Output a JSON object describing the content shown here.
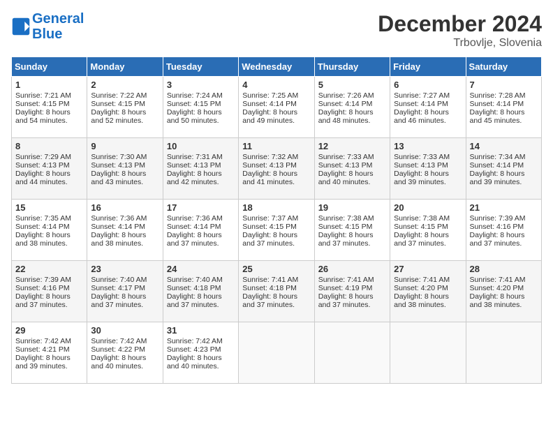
{
  "header": {
    "logo_line1": "General",
    "logo_line2": "Blue",
    "month_title": "December 2024",
    "location": "Trbovlje, Slovenia"
  },
  "days_of_week": [
    "Sunday",
    "Monday",
    "Tuesday",
    "Wednesday",
    "Thursday",
    "Friday",
    "Saturday"
  ],
  "weeks": [
    [
      {
        "day": "1",
        "lines": [
          "Sunrise: 7:21 AM",
          "Sunset: 4:15 PM",
          "Daylight: 8 hours",
          "and 54 minutes."
        ]
      },
      {
        "day": "2",
        "lines": [
          "Sunrise: 7:22 AM",
          "Sunset: 4:15 PM",
          "Daylight: 8 hours",
          "and 52 minutes."
        ]
      },
      {
        "day": "3",
        "lines": [
          "Sunrise: 7:24 AM",
          "Sunset: 4:15 PM",
          "Daylight: 8 hours",
          "and 50 minutes."
        ]
      },
      {
        "day": "4",
        "lines": [
          "Sunrise: 7:25 AM",
          "Sunset: 4:14 PM",
          "Daylight: 8 hours",
          "and 49 minutes."
        ]
      },
      {
        "day": "5",
        "lines": [
          "Sunrise: 7:26 AM",
          "Sunset: 4:14 PM",
          "Daylight: 8 hours",
          "and 48 minutes."
        ]
      },
      {
        "day": "6",
        "lines": [
          "Sunrise: 7:27 AM",
          "Sunset: 4:14 PM",
          "Daylight: 8 hours",
          "and 46 minutes."
        ]
      },
      {
        "day": "7",
        "lines": [
          "Sunrise: 7:28 AM",
          "Sunset: 4:14 PM",
          "Daylight: 8 hours",
          "and 45 minutes."
        ]
      }
    ],
    [
      {
        "day": "8",
        "lines": [
          "Sunrise: 7:29 AM",
          "Sunset: 4:13 PM",
          "Daylight: 8 hours",
          "and 44 minutes."
        ]
      },
      {
        "day": "9",
        "lines": [
          "Sunrise: 7:30 AM",
          "Sunset: 4:13 PM",
          "Daylight: 8 hours",
          "and 43 minutes."
        ]
      },
      {
        "day": "10",
        "lines": [
          "Sunrise: 7:31 AM",
          "Sunset: 4:13 PM",
          "Daylight: 8 hours",
          "and 42 minutes."
        ]
      },
      {
        "day": "11",
        "lines": [
          "Sunrise: 7:32 AM",
          "Sunset: 4:13 PM",
          "Daylight: 8 hours",
          "and 41 minutes."
        ]
      },
      {
        "day": "12",
        "lines": [
          "Sunrise: 7:33 AM",
          "Sunset: 4:13 PM",
          "Daylight: 8 hours",
          "and 40 minutes."
        ]
      },
      {
        "day": "13",
        "lines": [
          "Sunrise: 7:33 AM",
          "Sunset: 4:13 PM",
          "Daylight: 8 hours",
          "and 39 minutes."
        ]
      },
      {
        "day": "14",
        "lines": [
          "Sunrise: 7:34 AM",
          "Sunset: 4:14 PM",
          "Daylight: 8 hours",
          "and 39 minutes."
        ]
      }
    ],
    [
      {
        "day": "15",
        "lines": [
          "Sunrise: 7:35 AM",
          "Sunset: 4:14 PM",
          "Daylight: 8 hours",
          "and 38 minutes."
        ]
      },
      {
        "day": "16",
        "lines": [
          "Sunrise: 7:36 AM",
          "Sunset: 4:14 PM",
          "Daylight: 8 hours",
          "and 38 minutes."
        ]
      },
      {
        "day": "17",
        "lines": [
          "Sunrise: 7:36 AM",
          "Sunset: 4:14 PM",
          "Daylight: 8 hours",
          "and 37 minutes."
        ]
      },
      {
        "day": "18",
        "lines": [
          "Sunrise: 7:37 AM",
          "Sunset: 4:15 PM",
          "Daylight: 8 hours",
          "and 37 minutes."
        ]
      },
      {
        "day": "19",
        "lines": [
          "Sunrise: 7:38 AM",
          "Sunset: 4:15 PM",
          "Daylight: 8 hours",
          "and 37 minutes."
        ]
      },
      {
        "day": "20",
        "lines": [
          "Sunrise: 7:38 AM",
          "Sunset: 4:15 PM",
          "Daylight: 8 hours",
          "and 37 minutes."
        ]
      },
      {
        "day": "21",
        "lines": [
          "Sunrise: 7:39 AM",
          "Sunset: 4:16 PM",
          "Daylight: 8 hours",
          "and 37 minutes."
        ]
      }
    ],
    [
      {
        "day": "22",
        "lines": [
          "Sunrise: 7:39 AM",
          "Sunset: 4:16 PM",
          "Daylight: 8 hours",
          "and 37 minutes."
        ]
      },
      {
        "day": "23",
        "lines": [
          "Sunrise: 7:40 AM",
          "Sunset: 4:17 PM",
          "Daylight: 8 hours",
          "and 37 minutes."
        ]
      },
      {
        "day": "24",
        "lines": [
          "Sunrise: 7:40 AM",
          "Sunset: 4:18 PM",
          "Daylight: 8 hours",
          "and 37 minutes."
        ]
      },
      {
        "day": "25",
        "lines": [
          "Sunrise: 7:41 AM",
          "Sunset: 4:18 PM",
          "Daylight: 8 hours",
          "and 37 minutes."
        ]
      },
      {
        "day": "26",
        "lines": [
          "Sunrise: 7:41 AM",
          "Sunset: 4:19 PM",
          "Daylight: 8 hours",
          "and 37 minutes."
        ]
      },
      {
        "day": "27",
        "lines": [
          "Sunrise: 7:41 AM",
          "Sunset: 4:20 PM",
          "Daylight: 8 hours",
          "and 38 minutes."
        ]
      },
      {
        "day": "28",
        "lines": [
          "Sunrise: 7:41 AM",
          "Sunset: 4:20 PM",
          "Daylight: 8 hours",
          "and 38 minutes."
        ]
      }
    ],
    [
      {
        "day": "29",
        "lines": [
          "Sunrise: 7:42 AM",
          "Sunset: 4:21 PM",
          "Daylight: 8 hours",
          "and 39 minutes."
        ]
      },
      {
        "day": "30",
        "lines": [
          "Sunrise: 7:42 AM",
          "Sunset: 4:22 PM",
          "Daylight: 8 hours",
          "and 40 minutes."
        ]
      },
      {
        "day": "31",
        "lines": [
          "Sunrise: 7:42 AM",
          "Sunset: 4:23 PM",
          "Daylight: 8 hours",
          "and 40 minutes."
        ]
      },
      null,
      null,
      null,
      null
    ]
  ]
}
